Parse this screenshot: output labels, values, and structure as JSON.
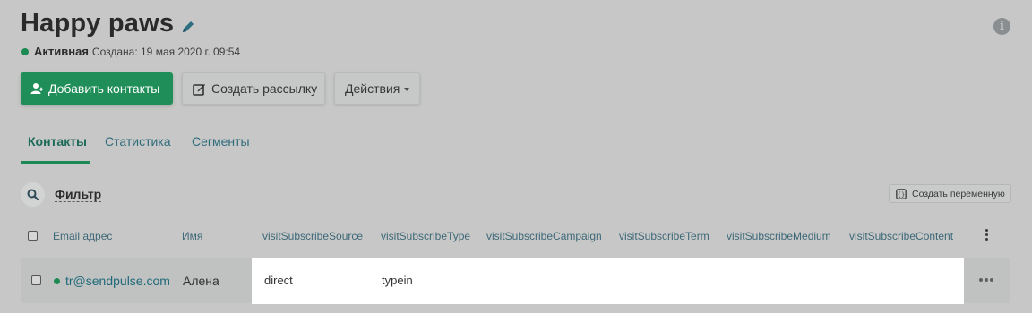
{
  "header": {
    "title": "Happy paws",
    "status": "Активная",
    "created": "Создана: 19 мая 2020 г. 09:54"
  },
  "buttons": {
    "add_contacts": "Добавить контакты",
    "create_campaign": "Создать рассылку",
    "actions": "Действия"
  },
  "tabs": [
    {
      "label": "Контакты",
      "active": true
    },
    {
      "label": "Статистика",
      "active": false
    },
    {
      "label": "Сегменты",
      "active": false
    }
  ],
  "toolbar": {
    "filter_label": "Фильтр",
    "create_variable": "Создать переменную"
  },
  "table": {
    "columns": [
      "Email адрес",
      "Имя",
      "visitSubscribeSource",
      "visitSubscribeType",
      "visitSubscribeCampaign",
      "visitSubscribeTerm",
      "visitSubscribeMedium",
      "visitSubscribeContent"
    ],
    "rows": [
      {
        "email": "tr@sendpulse.com",
        "name": "Алена",
        "source": "direct",
        "type": "typein"
      }
    ]
  },
  "colors": {
    "accent_green": "#208e58",
    "link_teal": "#1f6a7a",
    "overlay_gray": "#c6c7c6"
  },
  "icons": [
    "pencil-icon",
    "info-icon",
    "user-plus-icon",
    "edit-square-icon",
    "caret-down-icon",
    "search-icon",
    "variable-icon",
    "kebab-icon",
    "more-icon"
  ]
}
